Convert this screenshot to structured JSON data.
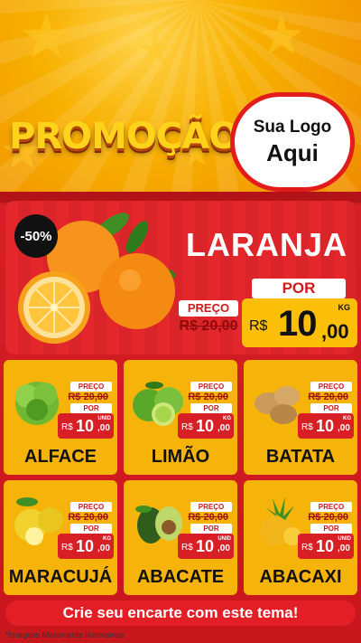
{
  "header": {
    "promo_title": "PROMOÇÃO",
    "logo_line1": "Sua Logo",
    "logo_line2": "Aqui"
  },
  "featured": {
    "discount": "-50%",
    "name": "LARANJA",
    "old_label": "PREÇO",
    "old_price": "R$ 20,00",
    "new_label": "POR",
    "currency": "R$",
    "new_price_int": "10",
    "new_price_dec": ",00",
    "unit": "KG",
    "icon": "orange-image"
  },
  "products": [
    {
      "name": "ALFACE",
      "old_label": "PREÇO",
      "old_price": "R$ 20,00",
      "new_label": "POR",
      "currency": "R$",
      "price_int": "10",
      "price_dec": ",00",
      "unit": "UNID",
      "icon": "lettuce-image"
    },
    {
      "name": "LIMÃO",
      "old_label": "PREÇO",
      "old_price": "R$ 20,00",
      "new_label": "POR",
      "currency": "R$",
      "price_int": "10",
      "price_dec": ",00",
      "unit": "KG",
      "icon": "lime-image"
    },
    {
      "name": "BATATA",
      "old_label": "PREÇO",
      "old_price": "R$ 20,00",
      "new_label": "POR",
      "currency": "R$",
      "price_int": "10",
      "price_dec": ",00",
      "unit": "KG",
      "icon": "potato-image"
    },
    {
      "name": "MARACUJÁ",
      "old_label": "PREÇO",
      "old_price": "R$ 20,00",
      "new_label": "POR",
      "currency": "R$",
      "price_int": "10",
      "price_dec": ",00",
      "unit": "KG",
      "icon": "passion-fruit-image"
    },
    {
      "name": "ABACATE",
      "old_label": "PREÇO",
      "old_price": "R$ 20,00",
      "new_label": "POR",
      "currency": "R$",
      "price_int": "10",
      "price_dec": ",00",
      "unit": "UNID",
      "icon": "avocado-image"
    },
    {
      "name": "ABACAXI",
      "old_label": "PREÇO",
      "old_price": "R$ 20,00",
      "new_label": "POR",
      "currency": "R$",
      "price_int": "10",
      "price_dec": ",00",
      "unit": "UNID",
      "icon": "pineapple-image"
    }
  ],
  "footer": {
    "cta": "Crie seu encarte com este tema!",
    "note": "*Imagens Meramente Ilustrativas"
  },
  "colors": {
    "brand_red": "#e21f26",
    "brand_yellow": "#f6b40a"
  }
}
